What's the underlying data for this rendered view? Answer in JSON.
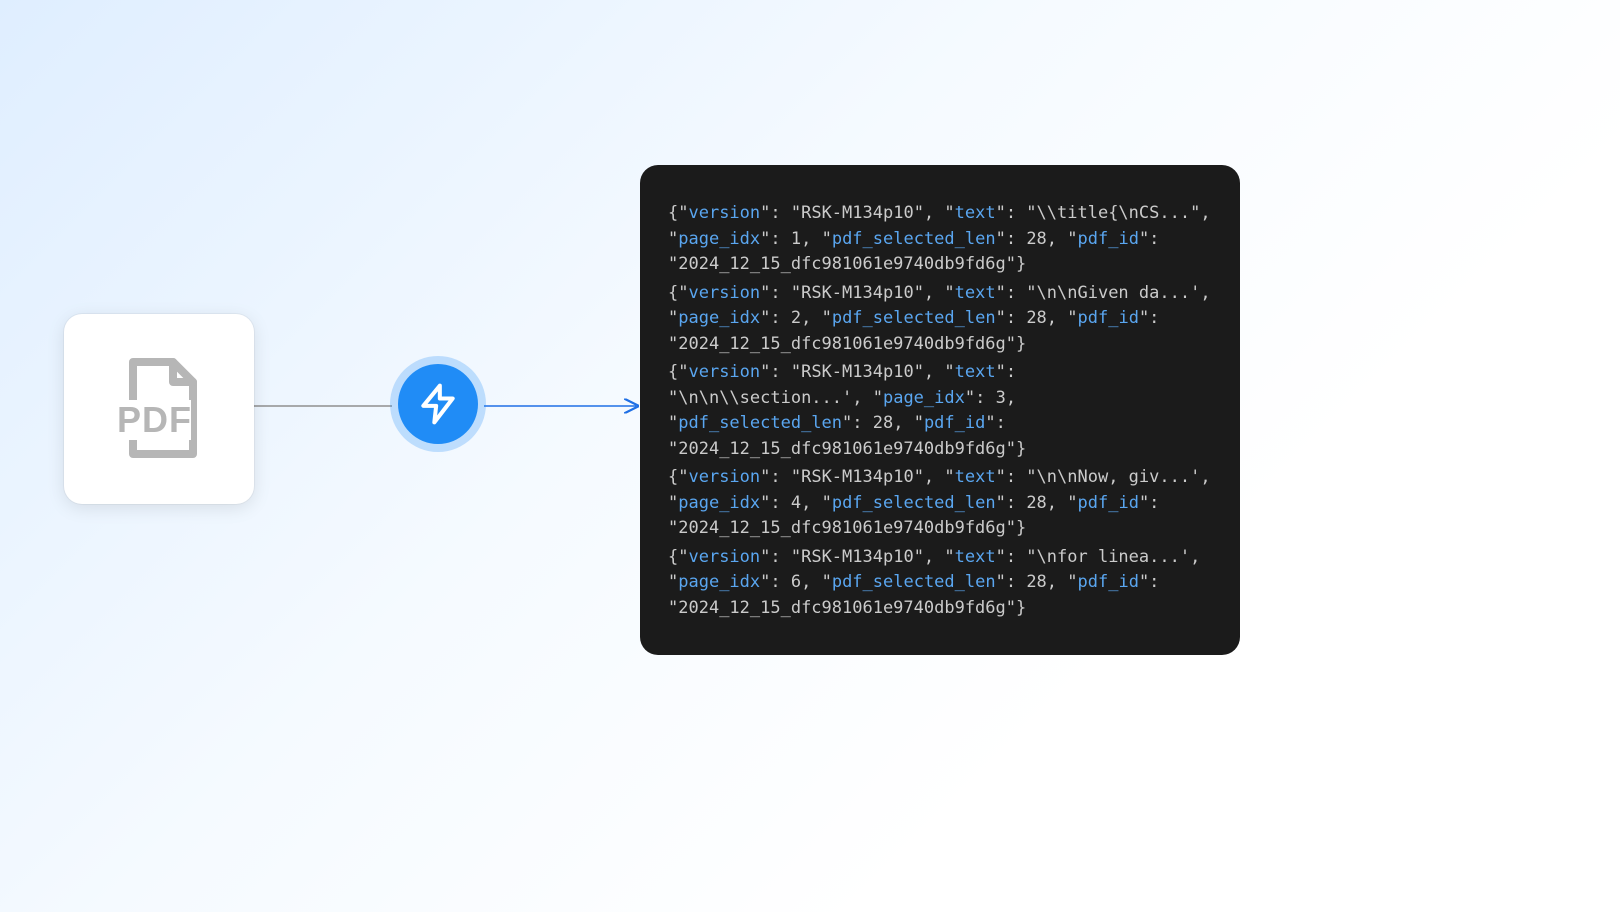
{
  "diagram": {
    "pdf_label": "PDF",
    "node_lightning": "lightning-processor",
    "json_entries": [
      {
        "version": "RSK-M134p10",
        "text": "\\\\title{\\nCS...",
        "page_idx": 1,
        "pdf_selected_len": 28,
        "pdf_id": "2024_12_15_dfc981061e9740db9fd6g",
        "text_terminator": "\","
      },
      {
        "version": "RSK-M134p10",
        "text": "\\n\\nGiven da...",
        "page_idx": 2,
        "pdf_selected_len": 28,
        "pdf_id": "2024_12_15_dfc981061e9740db9fd6g",
        "text_terminator": "',"
      },
      {
        "version": "RSK-M134p10",
        "text": "\\n\\n\\\\section...",
        "page_idx": 3,
        "pdf_selected_len": 28,
        "pdf_id": "2024_12_15_dfc981061e9740db9fd6g",
        "text_terminator": "',"
      },
      {
        "version": "RSK-M134p10",
        "text": "\\n\\nNow, giv...",
        "page_idx": 4,
        "pdf_selected_len": 28,
        "pdf_id": "2024_12_15_dfc981061e9740db9fd6g",
        "text_terminator": "',"
      },
      {
        "version": "RSK-M134p10",
        "text": "\\nfor linea...",
        "page_idx": 6,
        "pdf_selected_len": 28,
        "pdf_id": "2024_12_15_dfc981061e9740db9fd6g",
        "text_terminator": "',"
      }
    ]
  }
}
